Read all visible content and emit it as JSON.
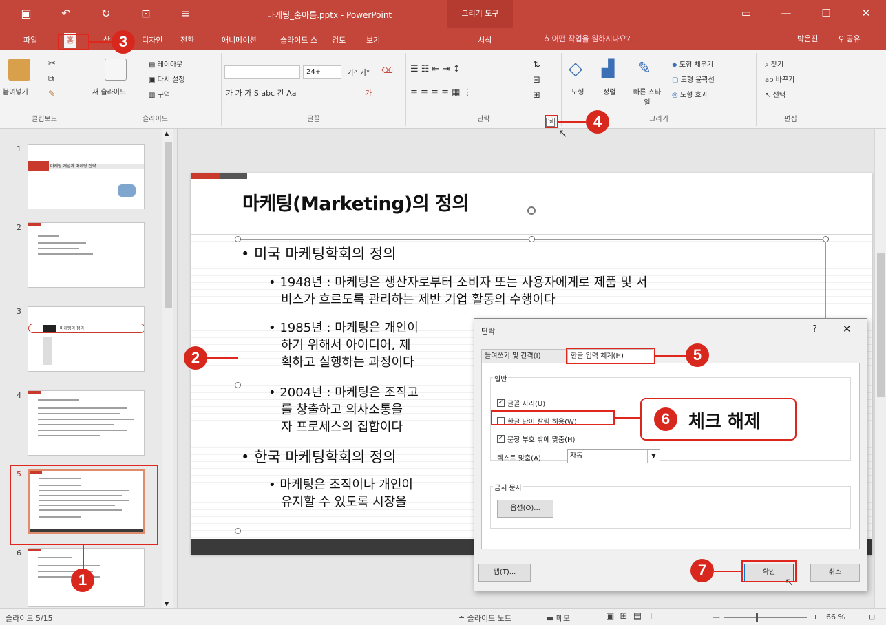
{
  "window": {
    "title": "마케팅_홍아름.pptx - PowerPoint",
    "contextual_tab_group": "그리기 도구"
  },
  "tabs": {
    "file": "파일",
    "home": "홈",
    "insert": "삽",
    "design": "디자인",
    "transitions": "전환",
    "animations": "애니메이션",
    "slideshow": "슬라이드 쇼",
    "review": "검토",
    "view": "보기",
    "format": "서식",
    "tell_me": "어떤 작업을 원하시나요?",
    "user": "박은진",
    "share": "공유"
  },
  "ribbon": {
    "clipboard": {
      "paste": "붙여넣기",
      "label": "클립보드"
    },
    "slides": {
      "new_slide": "새 슬라이드",
      "layout": "레이아웃",
      "reset": "다시 설정",
      "section": "구역",
      "label": "슬라이드"
    },
    "font": {
      "size": "24+",
      "label": "글꼴"
    },
    "paragraph": {
      "label": "단락"
    },
    "drawing": {
      "shapes": "도형",
      "arrange": "정렬",
      "quick_styles": "빠른 스타일",
      "fill": "도형 채우기",
      "outline": "도형 윤곽선",
      "effects": "도형 효과",
      "label": "그리기"
    },
    "editing": {
      "find": "찾기",
      "replace": "바꾸기",
      "select": "선택",
      "label": "편집"
    }
  },
  "thumbnails": {
    "items": [
      {
        "num": "1",
        "caption": "마케팅 개념과 마케팅 전략"
      },
      {
        "num": "2",
        "caption": ""
      },
      {
        "num": "3",
        "caption": "마케팅의 정의"
      },
      {
        "num": "4",
        "caption": ""
      },
      {
        "num": "5",
        "caption": ""
      },
      {
        "num": "6",
        "caption": ""
      }
    ]
  },
  "slide": {
    "title": "마케팅(Marketing)의 정의",
    "bullets": {
      "b1": "• 미국 마케팅학회의 정의",
      "b1_1a": "• 1948년 : 마케팅은 생산자로부터 소비자 또는 사용자에게로 제품 및 서",
      "b1_1b": "비스가 흐르도록 관리하는 제반 기업 활동의 수행이다",
      "b1_2a": "• 1985년 : 마케팅은 개인이",
      "b1_2b": "하기 위해서 아이디어, 제",
      "b1_2c": "획하고 실행하는 과정이다",
      "b1_3a": "• 2004년 : 마케팅은 조직고",
      "b1_3b": "를 창출하고 의사소통을",
      "b1_3c": "자 프로세스의 집합이다",
      "b2": "• 한국 마케팅학회의 정의",
      "b2_1a": "• 마케팅은 조직이나 개인이",
      "b2_1b": "유지할 수 있도록 시장을"
    }
  },
  "dialog": {
    "title": "단락",
    "help_glyph": "?",
    "close_glyph": "✕",
    "tab_indent": "들여쓰기 및 간격(I)",
    "tab_asian": "한글 입력 체계(H)",
    "group_general": "일반",
    "chk_punct": "글꼴 자리(U)",
    "chk_word_wrap": "한글 단어 잘림 허용(W)",
    "chk_hanging": "문장 부호 밖에 맞춤(H)",
    "text_align_label": "텍스트 맞춤(A)",
    "text_align_value": "자동",
    "group_chars": "금지 문자",
    "options_btn": "옵션(O)...",
    "tabs_btn": "탭(T)...",
    "ok_btn": "확인",
    "cancel_btn": "취소"
  },
  "statusbar": {
    "slide_info": "슬라이드 5/15",
    "notes": "슬라이드 노트",
    "comments": "메모",
    "zoom": "66 %"
  },
  "annotations": {
    "n1": "1",
    "n2": "2",
    "n3": "3",
    "n4": "4",
    "n5": "5",
    "n6": "6",
    "n7": "7",
    "callout_text": "체크 해제"
  },
  "colors": {
    "accent": "#c4463a",
    "annotation_red": "#d8281d"
  }
}
